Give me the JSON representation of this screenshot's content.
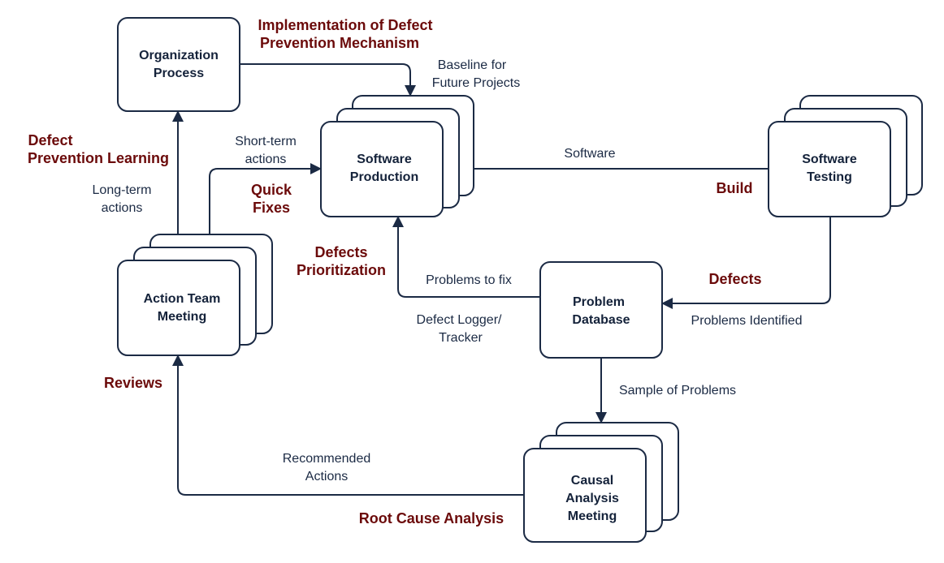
{
  "colors": {
    "stroke": "#1b2a44",
    "accent": "#6b0a0a",
    "background": "#ffffff"
  },
  "nodes": {
    "org": [
      "Organization",
      "Process"
    ],
    "production": [
      "Software",
      "Production"
    ],
    "testing": [
      "Software",
      "Testing"
    ],
    "action": [
      "Action Team",
      "Meeting"
    ],
    "database": [
      "Problem",
      "Database"
    ],
    "causal": [
      "Causal",
      "Analysis",
      "Meeting"
    ]
  },
  "edge_labels": {
    "baseline": [
      "Baseline for",
      "Future Projects"
    ],
    "short_term": [
      "Short-term",
      "actions"
    ],
    "long_term": [
      "Long-term",
      "actions"
    ],
    "software": "Software",
    "problems_to_fix": "Problems to fix",
    "logger": [
      "Defect Logger/",
      "Tracker"
    ],
    "problems_identified": "Problems Identified",
    "sample": "Sample of Problems",
    "recommended": [
      "Recommended",
      "Actions"
    ]
  },
  "stage_labels": {
    "implementation": [
      "Implementation of Defect",
      "Prevention Mechanism"
    ],
    "learning": [
      "Defect",
      "Prevention Learning"
    ],
    "quick_fixes": [
      "Quick",
      "Fixes"
    ],
    "build": "Build",
    "prioritization": [
      "Defects",
      "Prioritization"
    ],
    "defects": "Defects",
    "reviews": "Reviews",
    "root_cause": "Root Cause Analysis"
  }
}
